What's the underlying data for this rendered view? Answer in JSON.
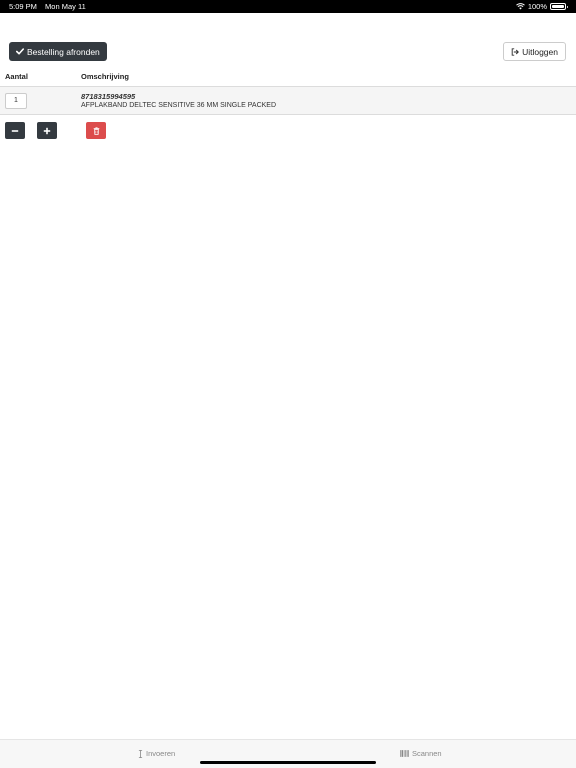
{
  "status_bar": {
    "time": "5:09 PM",
    "date": "Mon May 11",
    "battery": "100%",
    "icons": [
      "wifi-icon",
      "battery-icon"
    ]
  },
  "toolbar": {
    "finish_label": "Bestelling afronden",
    "finish_icon": "check-icon",
    "logout_label": "Uitloggen",
    "logout_icon": "sign-out-icon"
  },
  "table": {
    "headers": [
      "Aantal",
      "Omschrijving"
    ],
    "rows": [
      {
        "quantity": "1",
        "code": "8718315994595",
        "description": "AFPLAKBAND DELTEC SENSITIVE 36 MM SINGLE PACKED"
      }
    ]
  },
  "row_actions": {
    "decrease_icon": "minus-icon",
    "increase_icon": "plus-icon",
    "delete_icon": "trash-icon"
  },
  "tabs": [
    {
      "label": "Invoeren",
      "icon": "text-cursor-icon"
    },
    {
      "label": "Scannen",
      "icon": "barcode-icon"
    }
  ],
  "colors": {
    "primary_dark": "#343a40",
    "danger": "#dc4c4c",
    "row_bg": "#f5f5f5"
  }
}
